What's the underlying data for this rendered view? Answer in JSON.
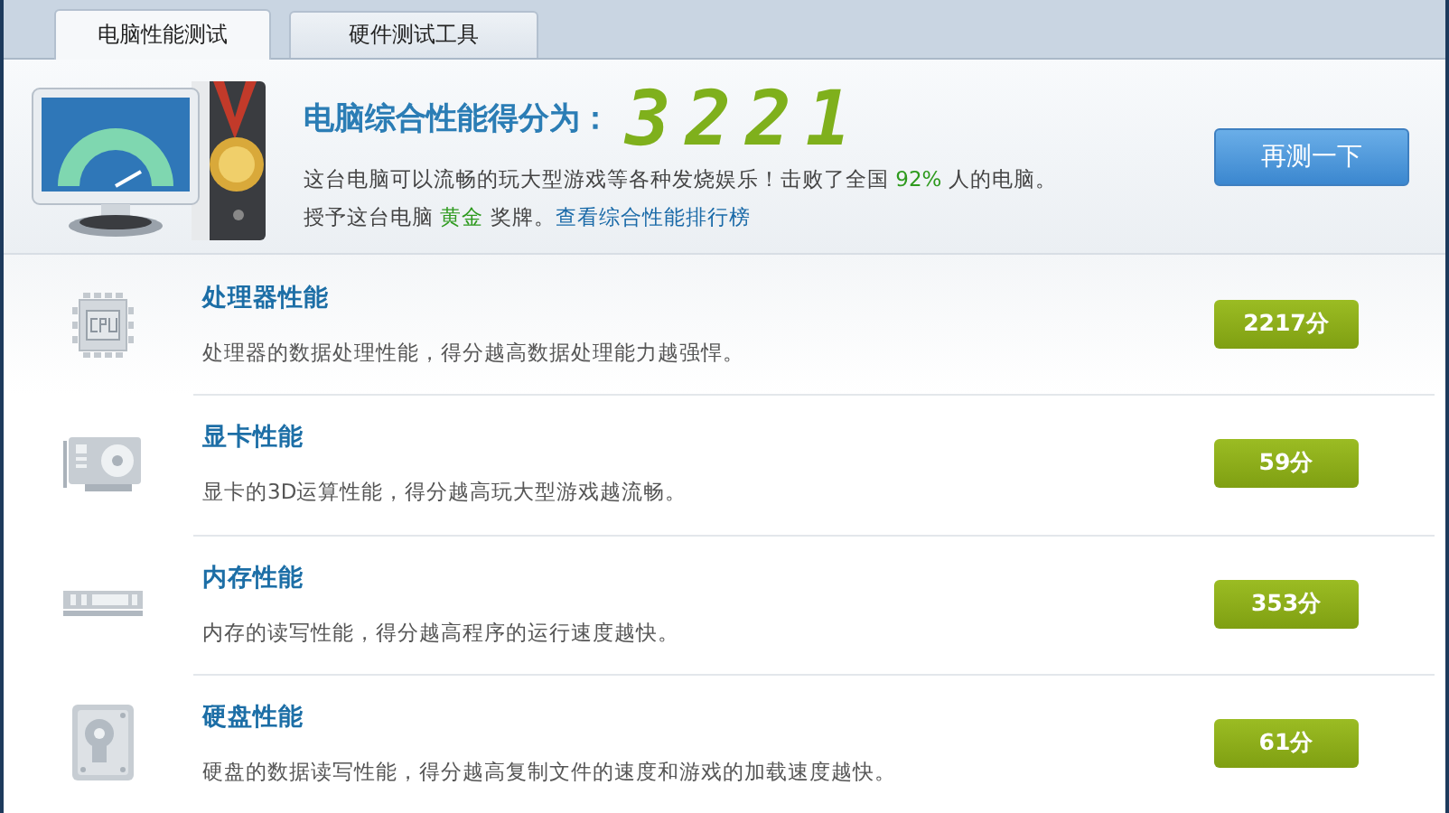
{
  "tabs": [
    {
      "label": "电脑性能测试",
      "selected": true
    },
    {
      "label": "硬件测试工具",
      "selected": false
    }
  ],
  "summary": {
    "title": "电脑综合性能得分为：",
    "score": "3221",
    "line_1": [
      {
        "kind": "text",
        "text": "这台电脑可以流畅的玩大型游戏等各种发烧娱乐！击败了全国 "
      },
      {
        "kind": "highlight",
        "text": "92%"
      },
      {
        "kind": "text",
        "text": " 人的电脑。"
      }
    ],
    "line_2": [
      {
        "kind": "text",
        "text": "授予这台电脑 "
      },
      {
        "kind": "highlight",
        "text": "黄金"
      },
      {
        "kind": "text",
        "text": " 奖牌。"
      },
      {
        "kind": "link",
        "text": "查看综合性能排行榜"
      }
    ],
    "retest_button": "再测一下"
  },
  "items": [
    {
      "kind": "cpu",
      "title": "处理器性能",
      "description": "处理器的数据处理性能，得分越高数据处理能力越强悍。",
      "score": "2217分"
    },
    {
      "kind": "gpu",
      "title": "显卡性能",
      "description": "显卡的3D运算性能，得分越高玩大型游戏越流畅。",
      "score": "59分"
    },
    {
      "kind": "memory",
      "title": "内存性能",
      "description": "内存的读写性能，得分越高程序的运行速度越快。",
      "score": "353分"
    },
    {
      "kind": "disk",
      "title": "硬盘性能",
      "description": "硬盘的数据读写性能，得分越高复制文件的速度和游戏的加载速度越快。",
      "score": "61分"
    }
  ]
}
